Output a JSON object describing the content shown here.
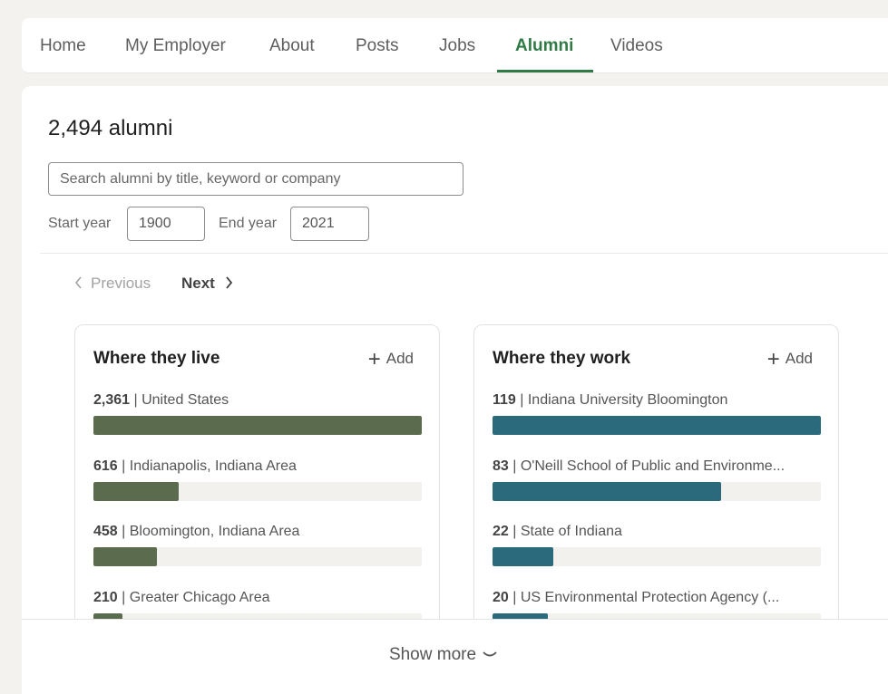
{
  "nav": {
    "tabs": [
      {
        "label": "Home"
      },
      {
        "label": "My Employer"
      },
      {
        "label": "About"
      },
      {
        "label": "Posts"
      },
      {
        "label": "Jobs"
      },
      {
        "label": "Alumni",
        "active": true
      },
      {
        "label": "Videos"
      }
    ]
  },
  "alumni": {
    "count_label": "2,494 alumni",
    "search_placeholder": "Search alumni by title, keyword or company",
    "start_year_label": "Start year",
    "start_year": "1900",
    "end_year_label": "End year",
    "end_year": "2021"
  },
  "pager": {
    "prev_label": "Previous",
    "next_label": "Next"
  },
  "where_live": {
    "title": "Where they live",
    "add_label": "Add",
    "bar_color": "#5b6b4e",
    "rows": [
      {
        "count": "2,361",
        "label": "United States",
        "fraction": 1.0
      },
      {
        "count": "616",
        "label": "Indianapolis, Indiana Area",
        "fraction": 0.261
      },
      {
        "count": "458",
        "label": "Bloomington, Indiana Area",
        "fraction": 0.194
      },
      {
        "count": "210",
        "label": "Greater Chicago Area",
        "fraction": 0.089
      }
    ]
  },
  "where_work": {
    "title": "Where they work",
    "add_label": "Add",
    "bar_color": "#2b6a7c",
    "rows": [
      {
        "count": "119",
        "label": "Indiana University Bloomington",
        "fraction": 1.0
      },
      {
        "count": "83",
        "label": "O'Neill School of Public and Environme...",
        "fraction": 0.697
      },
      {
        "count": "22",
        "label": "State of Indiana",
        "fraction": 0.185
      },
      {
        "count": "20",
        "label": "US Environmental Protection Agency (...",
        "fraction": 0.168
      }
    ]
  },
  "show_more_label": "Show more",
  "colors": {
    "accent": "#2f7a45",
    "page_bg": "#f3f2ef"
  },
  "icons": {
    "prev": "chevron-left-icon",
    "next": "chevron-right-icon",
    "add": "plus-icon",
    "show_more": "chevron-down-icon"
  }
}
